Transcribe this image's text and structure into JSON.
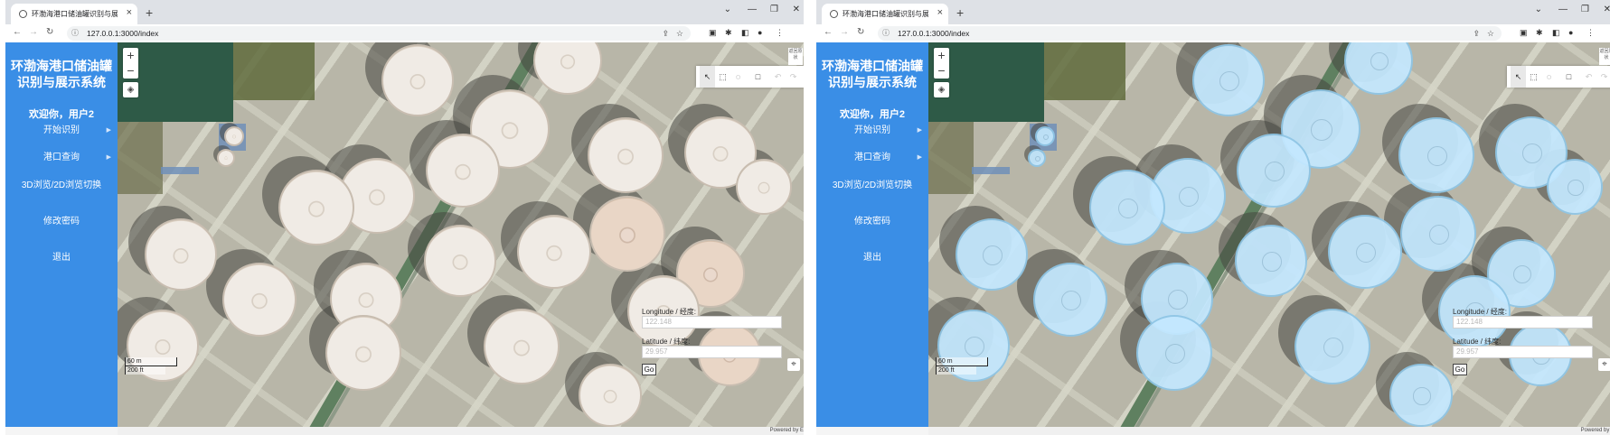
{
  "browser": {
    "tab_title": "环渤海港口储油罐识别与展示系统",
    "tab_close": "×",
    "new_tab": "+",
    "url_prefix": "127.0.0.1",
    "url": "127.0.0.1:3000/index",
    "window_controls": [
      "⌄",
      "—",
      "❐",
      "✕"
    ]
  },
  "sidebar": {
    "app_title_line1": "环渤海港口储油罐",
    "app_title_line2": "识别与展示系统",
    "welcome": "欢迎你，用户2",
    "items": [
      {
        "label": "开始识别",
        "has_arrow": true
      },
      {
        "label": "港口查询",
        "has_arrow": true
      },
      {
        "label": "3D浏览/2D浏览切换",
        "has_arrow": false
      },
      {
        "label": "修改密码",
        "has_arrow": false
      },
      {
        "label": "退出",
        "has_arrow": false
      }
    ]
  },
  "map": {
    "zoom_in": "+",
    "zoom_out": "−",
    "corner_button": "返回原状",
    "coord_panel": {
      "longitude_label": "Longitude / 经度:",
      "longitude_placeholder": "122.148",
      "latitude_label": "Latitude / 纬度:",
      "latitude_placeholder": "29.957",
      "go_label": "Go"
    },
    "scale_metric": "60 m",
    "scale_imperial": "200 ft",
    "attribution": "Powered by E"
  },
  "views": [
    {
      "name": "raw-imagery",
      "tank_state": "unrecognized"
    },
    {
      "name": "recognition-result",
      "tank_state": "detected",
      "highlight_color": "#c4e8ff"
    }
  ]
}
